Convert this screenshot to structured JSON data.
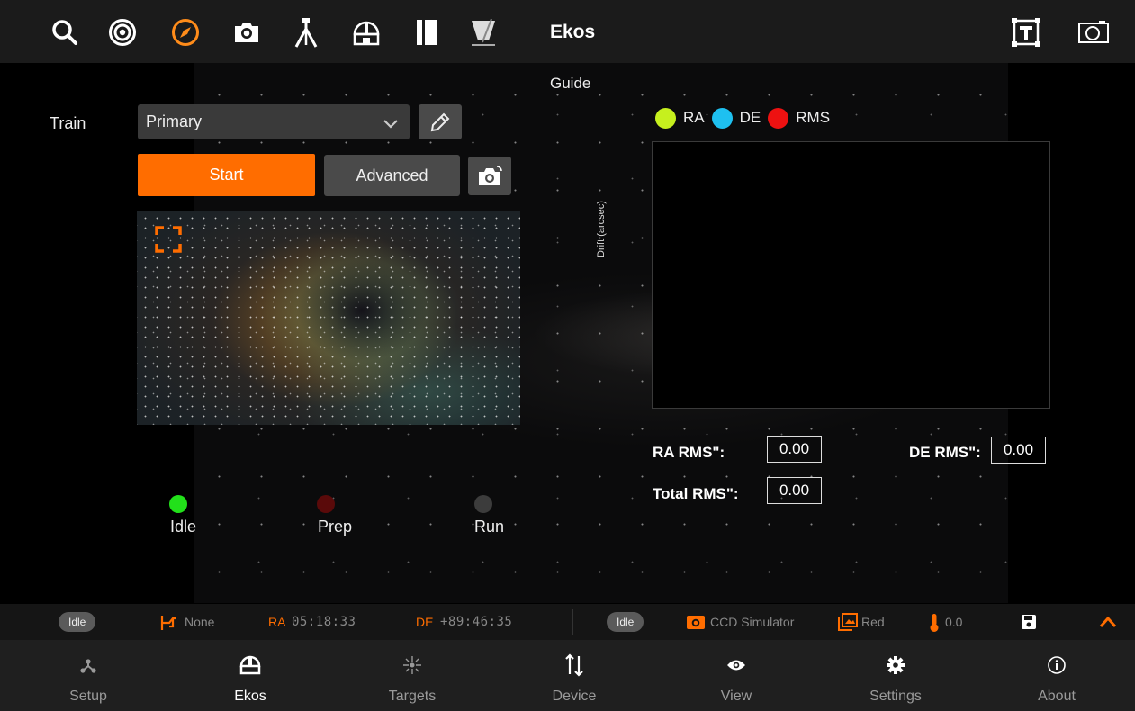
{
  "app": {
    "title": "Ekos",
    "module_title": "Guide"
  },
  "toolbar": {
    "icons": [
      "search-icon",
      "target-icon",
      "compass-icon",
      "camera-icon",
      "tripod-icon",
      "dome-icon",
      "flat-panel-icon",
      "dust-cap-icon"
    ],
    "active_icon": "compass-icon",
    "right_icons": [
      "text-frame-icon",
      "screenshot-icon"
    ]
  },
  "guide": {
    "train_label": "Train",
    "train_value": "Primary",
    "start_label": "Start",
    "advanced_label": "Advanced",
    "states": [
      {
        "label": "Idle",
        "color": "#22e01a",
        "active": true
      },
      {
        "label": "Prep",
        "color": "#5a0a0a",
        "active": false
      },
      {
        "label": "Run",
        "color": "#3c3c3c",
        "active": false
      }
    ]
  },
  "graph": {
    "legend": [
      {
        "label": "RA",
        "color": "#c6f01e"
      },
      {
        "label": "DE",
        "color": "#1ec0f0"
      },
      {
        "label": "RMS",
        "color": "#ee1111"
      }
    ],
    "y_axis_label": "Drift (arcsec)",
    "ra_rms_label": "RA RMS\":",
    "ra_rms_value": "0.00",
    "de_rms_label": "DE RMS\":",
    "de_rms_value": "0.00",
    "total_rms_label": "Total RMS\":",
    "total_rms_value": "0.00"
  },
  "statusbar": {
    "left_state": "Idle",
    "pier_side": "None",
    "ra_label": "RA",
    "ra_value": "05:18:33",
    "de_label": "DE",
    "de_value": "+89:46:35",
    "right_state": "Idle",
    "camera": "CCD Simulator",
    "filter": "Red",
    "temperature": "0.0",
    "accent": "#ff6d00"
  },
  "nav": {
    "items": [
      {
        "label": "Setup",
        "icon": "setup-icon"
      },
      {
        "label": "Ekos",
        "icon": "ekos-icon"
      },
      {
        "label": "Targets",
        "icon": "targets-icon"
      },
      {
        "label": "Device",
        "icon": "device-icon"
      },
      {
        "label": "View",
        "icon": "eye-icon"
      },
      {
        "label": "Settings",
        "icon": "gear-icon"
      },
      {
        "label": "About",
        "icon": "info-icon"
      }
    ],
    "active": "Ekos"
  }
}
